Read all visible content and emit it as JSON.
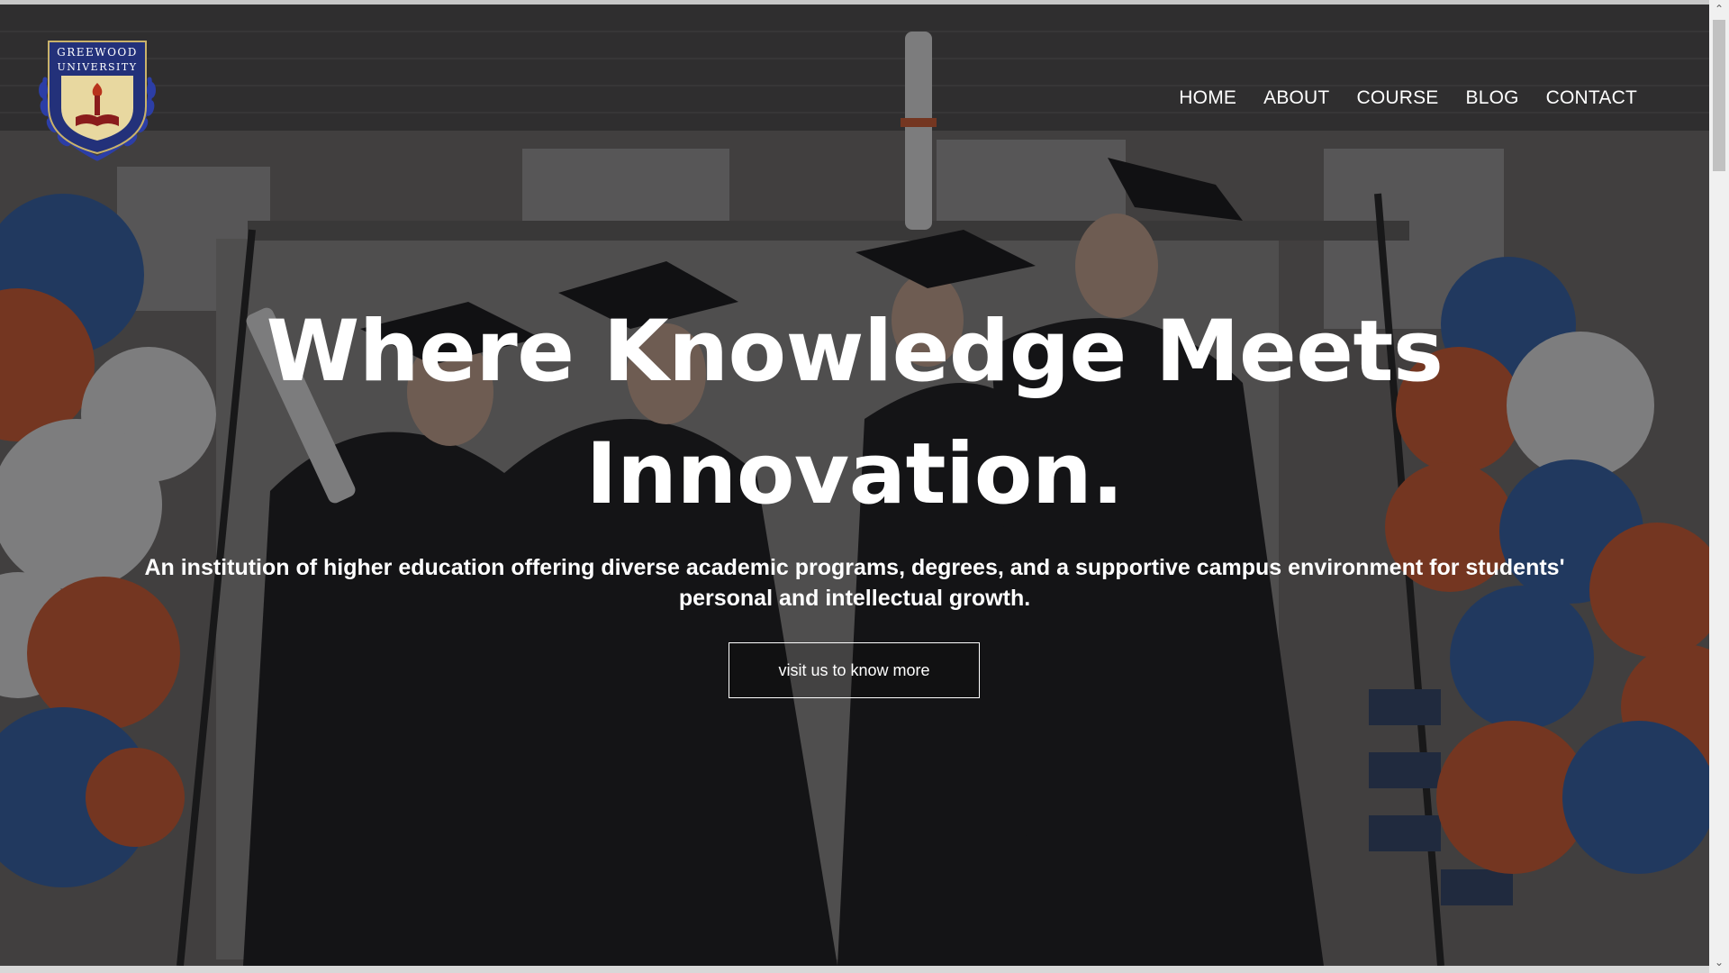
{
  "logo": {
    "line1": "GREEWOOD",
    "line2": "UNIVERSITY"
  },
  "nav": {
    "items": [
      {
        "label": "HOME"
      },
      {
        "label": "ABOUT"
      },
      {
        "label": "COURSE"
      },
      {
        "label": "BLOG"
      },
      {
        "label": "CONTACT"
      }
    ]
  },
  "hero": {
    "headline_line1": "Where Knowledge Meets",
    "headline_line2": "Innovation.",
    "subtext": "An institution of higher education offering diverse academic programs, degrees, and a supportive campus environment for students' personal and intellectual growth.",
    "cta_label": "visit us to know more"
  },
  "scrollbar": {
    "up_arrow": "⌃",
    "down_arrow": "⌄"
  },
  "colors": {
    "balloon_blue": "#2f5fa8",
    "balloon_orange": "#d4582c",
    "balloon_white": "#e6e6e6",
    "gown": "#121214",
    "logo_navy": "#23317a",
    "logo_gold": "#e8d8a0"
  }
}
